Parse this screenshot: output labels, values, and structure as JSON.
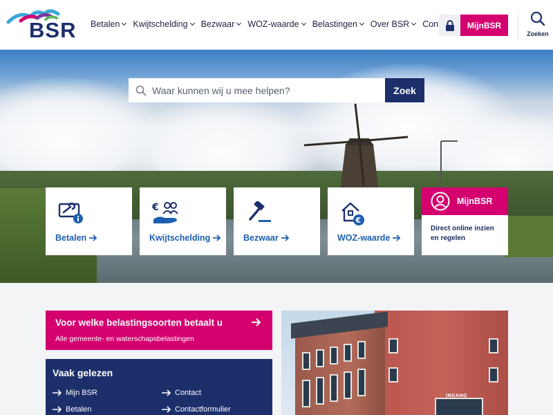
{
  "header": {
    "logo_text": "BSR",
    "nav": [
      {
        "label": "Betalen",
        "has_dropdown": true
      },
      {
        "label": "Kwijtschelding",
        "has_dropdown": true
      },
      {
        "label": "Bezwaar",
        "has_dropdown": true
      },
      {
        "label": "WOZ-waarde",
        "has_dropdown": true
      },
      {
        "label": "Belastingen",
        "has_dropdown": true
      },
      {
        "label": "Over BSR",
        "has_dropdown": true
      },
      {
        "label": "Contact",
        "has_dropdown": false
      }
    ],
    "mijn_label": "MijnBSR",
    "search_label": "Zoeken"
  },
  "hero": {
    "search_placeholder": "Waar kunnen wij u mee helpen?",
    "search_button": "Zoek",
    "tiles": [
      {
        "label": "Betalen",
        "icon": "wrench-card-icon"
      },
      {
        "label": "Kwijtschelding",
        "icon": "euro-people-hand-icon"
      },
      {
        "label": "Bezwaar",
        "icon": "gavel-icon"
      },
      {
        "label": "WOZ-waarde",
        "icon": "house-euro-icon"
      }
    ],
    "mijn_tile": {
      "title": "MijnBSR",
      "text": "Direct online inzien en regelen"
    }
  },
  "promo": {
    "title": "Voor welke belastingsoorten betaalt u",
    "subtitle": "Alle gemeente- en waterschapsbelastingen"
  },
  "vaak_gelezen": {
    "title": "Vaak gelezen",
    "links": [
      "Mijn BSR",
      "Contact",
      "Betalen",
      "Contactformulier"
    ]
  },
  "photo": {
    "sign_text": "INGANG"
  },
  "colors": {
    "brand_navy": "#1c2f6b",
    "brand_pink": "#d4006f",
    "link_blue": "#1d5fb0"
  }
}
